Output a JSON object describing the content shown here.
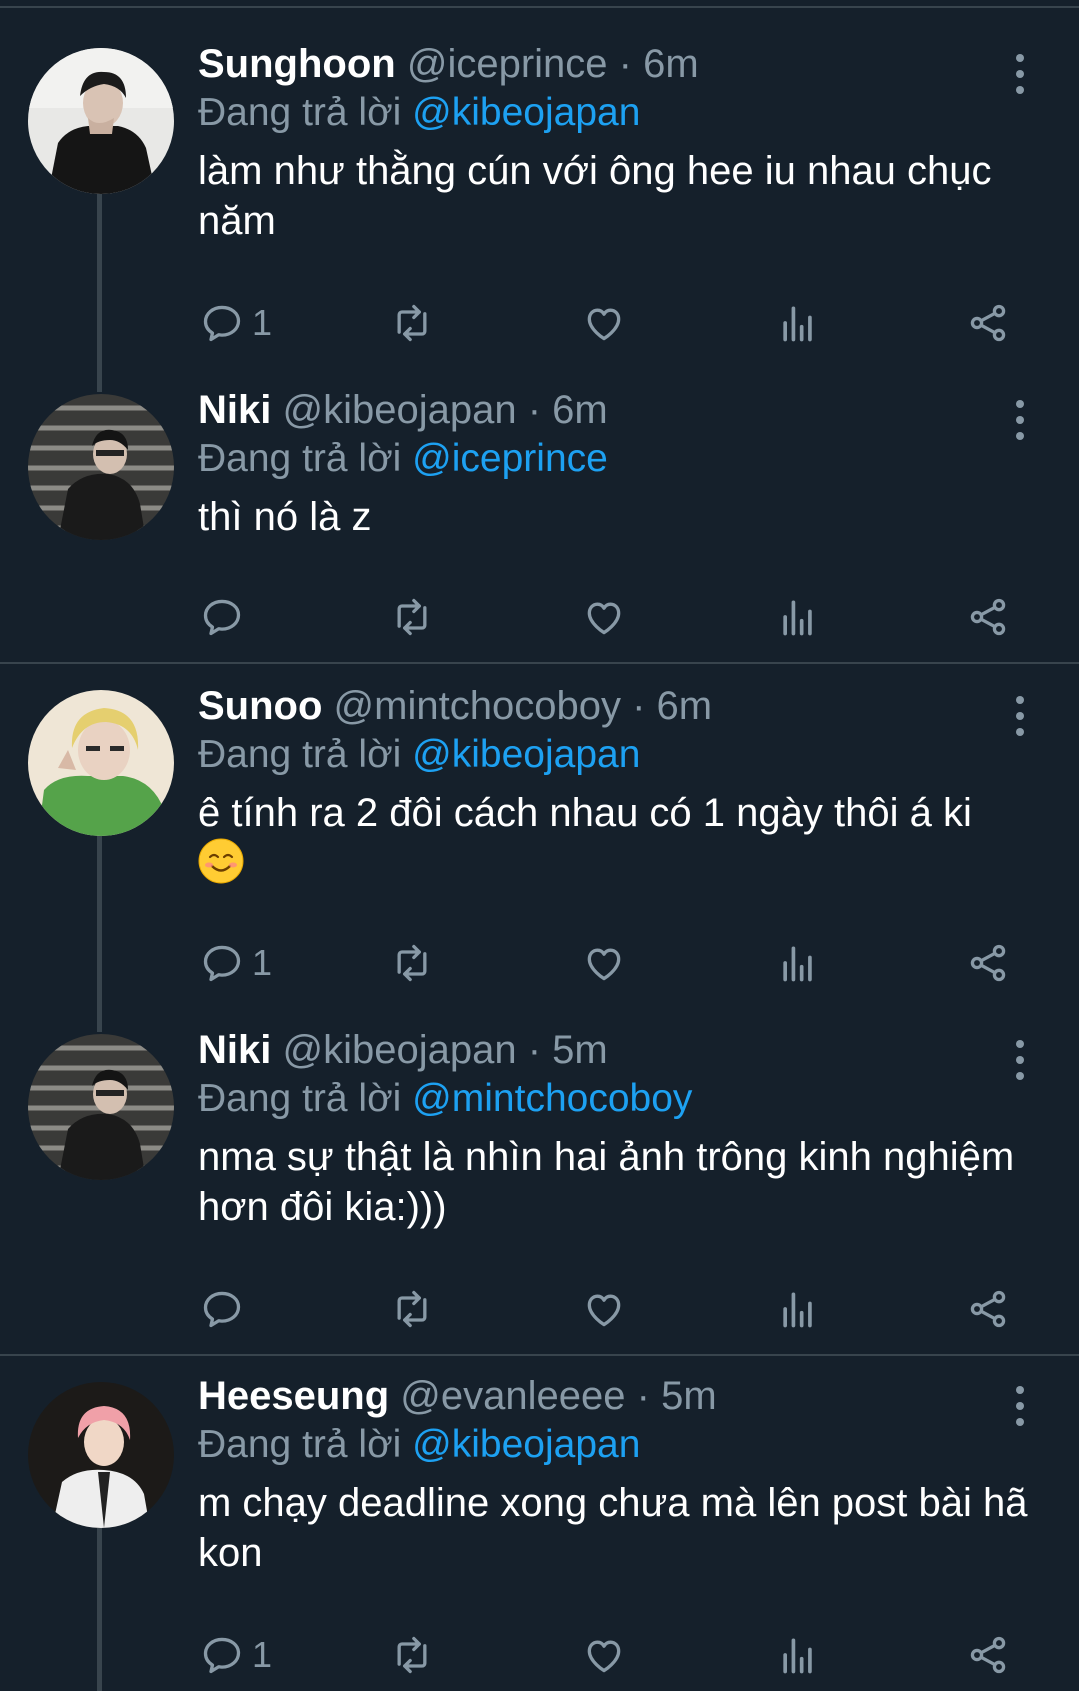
{
  "reply_prefix": "Đang trả lời ",
  "colors": {
    "background": "#15202b",
    "muted": "#8899a6",
    "link": "#1da1f2",
    "border": "#38444d"
  },
  "tweets": [
    {
      "name": "Sunghoon",
      "handle": "@iceprince",
      "time": "6m",
      "reply_to": "@kibeojapan",
      "text": "làm như thằng cún với ông hee iu nhau chục năm",
      "reply_count": "1"
    },
    {
      "name": "Niki",
      "handle": "@kibeojapan",
      "time": "6m",
      "reply_to": "@iceprince",
      "text": "thì nó là z",
      "reply_count": ""
    },
    {
      "name": "Sunoo",
      "handle": "@mintchocoboy",
      "time": "6m",
      "reply_to": "@kibeojapan",
      "text": "ê tính ra 2 đôi cách nhau có 1 ngày thôi á ki",
      "emoji": "smiling-face-emoji",
      "reply_count": "1"
    },
    {
      "name": "Niki",
      "handle": "@kibeojapan",
      "time": "5m",
      "reply_to": "@mintchocoboy",
      "text": "nma sự thật là nhìn hai ảnh trông kinh nghiệm hơn đôi kia:)))",
      "reply_count": ""
    },
    {
      "name": "Heeseung",
      "handle": "@evanleeee",
      "time": "5m",
      "reply_to": "@kibeojapan",
      "text": "m chạy deadline xong chưa mà lên post bài hã kon",
      "reply_count": "1"
    }
  ],
  "icons": [
    "more-vert-icon",
    "reply-icon",
    "retweet-icon",
    "like-icon",
    "analytics-icon",
    "share-icon"
  ]
}
